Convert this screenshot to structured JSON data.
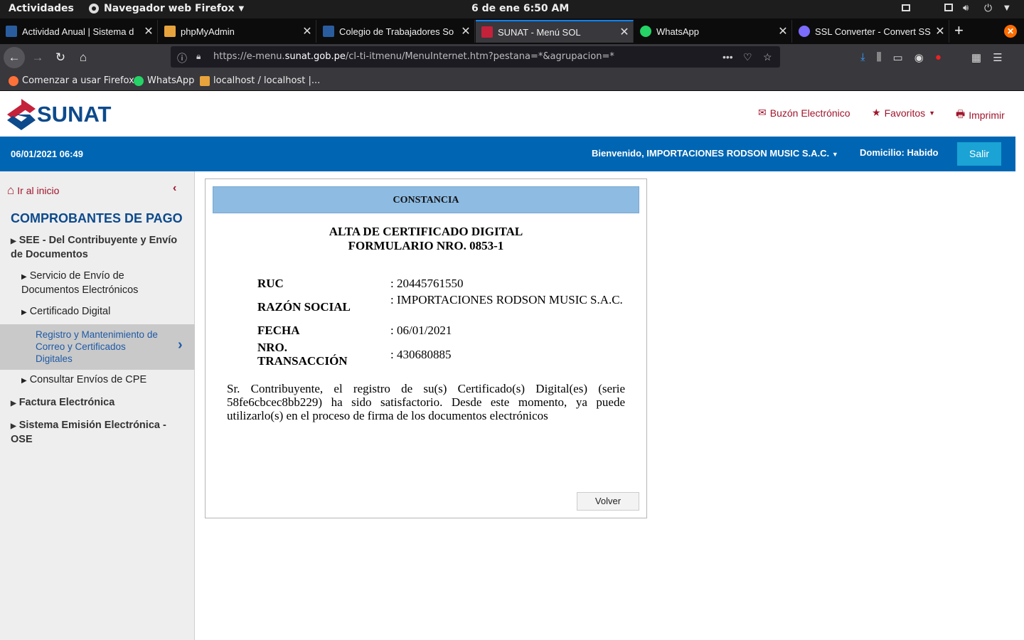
{
  "system": {
    "activities": "Actividades",
    "app_name": "Navegador web Firefox",
    "clock": "6 de ene   6:50 AM"
  },
  "tabs": [
    {
      "title": "Actividad Anual | Sistema d",
      "icon_color": "#2a5d9f"
    },
    {
      "title": "phpMyAdmin",
      "icon_color": "#e8a33d"
    },
    {
      "title": "Colegio de Trabajadores So",
      "icon_color": "#2a5d9f"
    },
    {
      "title": "SUNAT - Menú SOL",
      "icon_color": "#c4213b"
    },
    {
      "title": "WhatsApp",
      "icon_color": "#25d366"
    },
    {
      "title": "SSL Converter - Convert SS",
      "icon_color": "#7c6cff"
    }
  ],
  "url": {
    "prefix": "https://e-menu.",
    "domain": "sunat.gob.pe",
    "path": "/cl-ti-itmenu/MenuInternet.htm?pestana=*&agrupacion=*"
  },
  "bookmarks": [
    {
      "label": "Comenzar a usar Firefox",
      "icon_color": "#ff7139"
    },
    {
      "label": "WhatsApp",
      "icon_color": "#25d366"
    },
    {
      "label": "localhost / localhost |...",
      "icon_color": "#e8a33d"
    }
  ],
  "header": {
    "logo_text": "SUNAT",
    "buzon": "Buzón Electrónico",
    "favoritos": "Favoritos",
    "imprimir": "Imprimir"
  },
  "bluebar": {
    "datetime": "06/01/2021 06:49",
    "welcome": "Bienvenido, IMPORTACIONES RODSON MUSIC S.A.C.",
    "domicilio": "Domicilio: Habido",
    "salir": "Salir"
  },
  "sidebar": {
    "home": "Ir al inicio",
    "section_title": "COMPROBANTES DE PAGO",
    "items": [
      "SEE - Del Contribuyente y Envío de Documentos",
      "Servicio de Envío de Documentos Electrónicos",
      "Certificado Digital",
      "Registro y Mantenimiento de Correo y Certificados Digitales",
      "Consultar Envíos de CPE",
      "Factura Electrónica",
      "Sistema Emisión Electrónica - OSE"
    ]
  },
  "constancia": {
    "header": "CONSTANCIA",
    "title_line1": "ALTA DE CERTIFICADO DIGITAL",
    "title_line2": "FORMULARIO NRO. 0853-1",
    "ruc_label": "RUC",
    "ruc_value": ": 20445761550",
    "razon_label": "RAZÓN SOCIAL",
    "razon_value": ": IMPORTACIONES RODSON MUSIC S.A.C.",
    "fecha_label": "FECHA",
    "fecha_value": ": 06/01/2021",
    "nro_label_1": "NRO.",
    "nro_label_2": "TRANSACCIÓN",
    "nro_value": ": 430680885",
    "message": "Sr. Contribuyente, el registro de su(s) Certificado(s) Digital(es) (serie 58fe6cbcec8bb229) ha sido satisfactorio. Desde este momento, ya puede utilizarlo(s) en el proceso de firma de los documentos electrónicos",
    "volver": "Volver"
  }
}
